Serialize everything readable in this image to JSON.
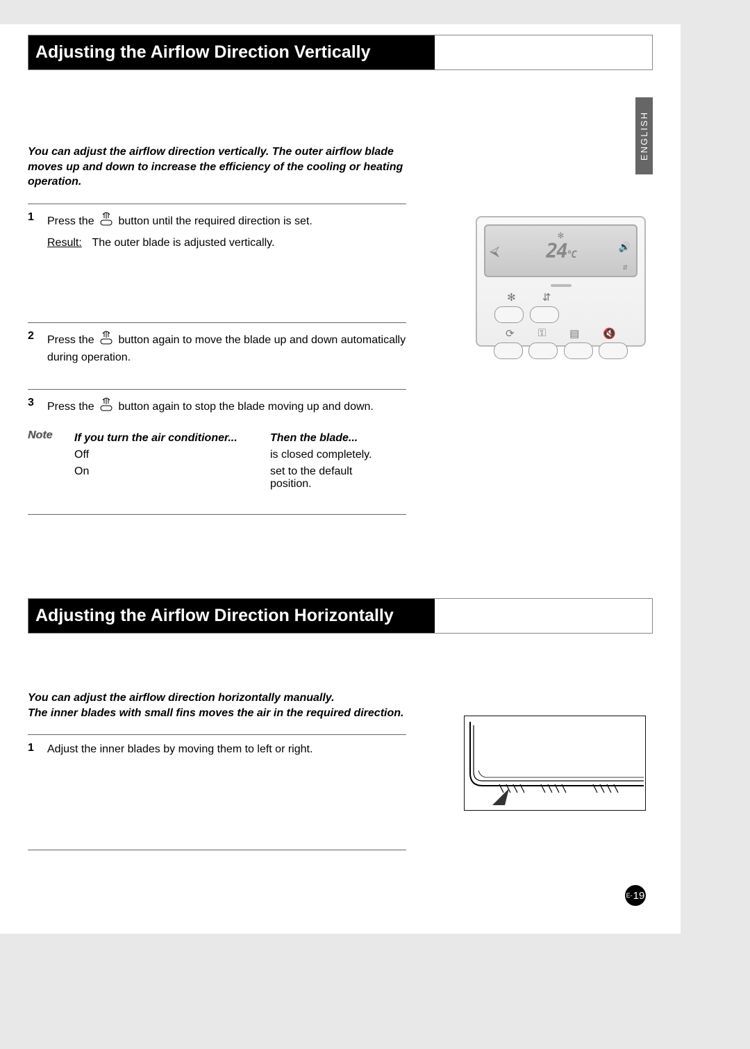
{
  "language_tab": "ENGLISH",
  "page_number_prefix": "E-",
  "page_number": "19",
  "section1": {
    "title": "Adjusting the Airflow Direction Vertically",
    "intro": "You can adjust the airflow direction vertically. The outer airflow blade moves up and down to increase the efficiency of the cooling or heating operation.",
    "steps": [
      {
        "num": "1",
        "icon": "swing-button-icon",
        "pre": "Press the ",
        "post": " button until the required direction is set.",
        "result_label": "Result:",
        "result_text": "The outer blade is adjusted vertically."
      },
      {
        "num": "2",
        "icon": "swing-button-icon",
        "pre": "Press the ",
        "post": " button again to move the blade up and down automatically during operation."
      },
      {
        "num": "3",
        "icon": "swing-button-icon",
        "pre": "Press the ",
        "post": " button again to stop the blade moving up and down."
      }
    ],
    "note": {
      "label": "Note",
      "header_left": "If you turn the air conditioner...",
      "header_right": "Then the blade...",
      "rows": [
        {
          "left": "Off",
          "right": "is closed completely."
        },
        {
          "left": "On",
          "right": "set to the default position."
        }
      ]
    },
    "remote": {
      "display_mode_icon": "snowflake-icon",
      "temperature": "24",
      "unit": "°C",
      "swing_indicator": "swing-icon",
      "row_icons": [
        "snowflake-mode-icon",
        "swing-icon",
        "sleep-icon",
        "mute-icon"
      ],
      "row2_icons": [
        "timer-icon",
        "key-icon",
        "list-icon",
        "sound-icon"
      ]
    }
  },
  "section2": {
    "title": "Adjusting the Airflow Direction Horizontally",
    "intro": "You can adjust the airflow direction horizontally manually.\nThe inner blades with small fins moves the air in the required direction.",
    "steps": [
      {
        "num": "1",
        "text": "Adjust the inner blades by moving them to left or right."
      }
    ]
  }
}
